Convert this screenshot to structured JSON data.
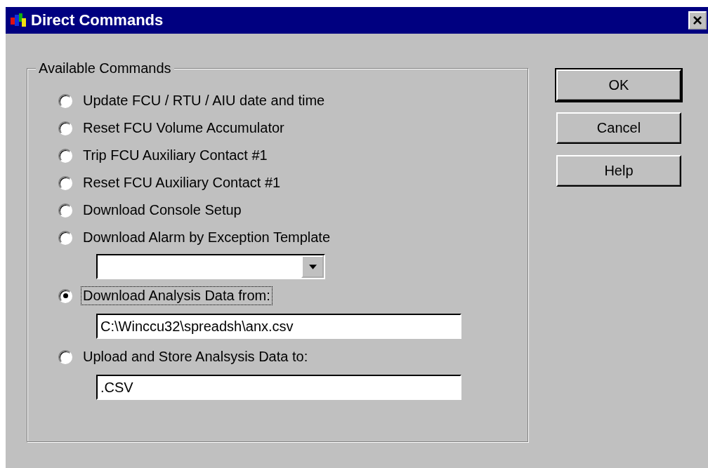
{
  "window": {
    "title": "Direct Commands",
    "close": "×"
  },
  "group": {
    "title": "Available Commands",
    "options": [
      {
        "kind": "radio",
        "label": "Update FCU / RTU / AIU date and time",
        "selected": false,
        "focused": false
      },
      {
        "kind": "radio",
        "label": "Reset FCU Volume Accumulator",
        "selected": false,
        "focused": false
      },
      {
        "kind": "radio",
        "label": "Trip FCU Auxiliary Contact #1",
        "selected": false,
        "focused": false
      },
      {
        "kind": "radio",
        "label": "Reset FCU Auxiliary Contact #1",
        "selected": false,
        "focused": false
      },
      {
        "kind": "radio",
        "label": "Download Console Setup",
        "selected": false,
        "focused": false
      },
      {
        "kind": "radio",
        "label": "Download Alarm by Exception Template",
        "selected": false,
        "focused": false
      },
      {
        "kind": "dropdown"
      },
      {
        "kind": "radio",
        "label": "Download Analysis Data from:",
        "selected": true,
        "focused": true
      },
      {
        "kind": "field",
        "value": "C:\\Winccu32\\spreadsh\\anx.csv"
      },
      {
        "kind": "radio",
        "label": "Upload and Store Analsysis Data to:",
        "selected": false,
        "focused": false
      },
      {
        "kind": "field",
        "value": ".CSV"
      }
    ]
  },
  "buttons": [
    {
      "label": "OK",
      "default": true
    },
    {
      "label": "Cancel",
      "default": false
    },
    {
      "label": "Help",
      "default": false
    }
  ]
}
